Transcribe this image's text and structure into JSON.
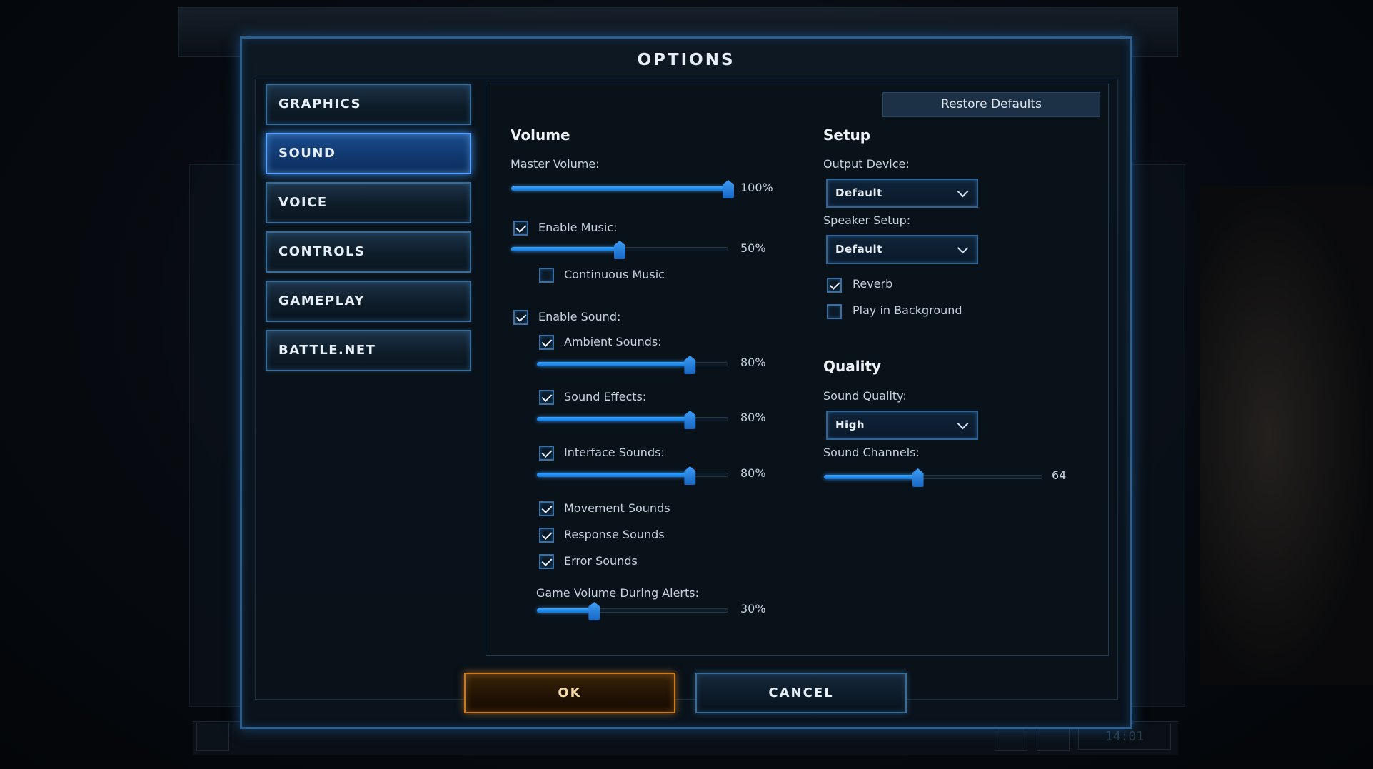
{
  "dialog": {
    "title": "OPTIONS"
  },
  "nav": {
    "items": [
      {
        "label": "GRAPHICS",
        "active": false
      },
      {
        "label": "SOUND",
        "active": true
      },
      {
        "label": "VOICE",
        "active": false
      },
      {
        "label": "CONTROLS",
        "active": false
      },
      {
        "label": "GAMEPLAY",
        "active": false
      },
      {
        "label": "BATTLE.NET",
        "active": false
      }
    ]
  },
  "restore_defaults_label": "Restore Defaults",
  "volume": {
    "title": "Volume",
    "master": {
      "label": "Master Volume:",
      "value": 1.0,
      "display": "100%"
    },
    "music": {
      "label": "Enable Music:",
      "checked": true,
      "value": 0.5,
      "display": "50%"
    },
    "continuous_music": {
      "label": "Continuous Music",
      "checked": false
    },
    "sound": {
      "label": "Enable Sound:",
      "checked": true
    },
    "ambient": {
      "label": "Ambient Sounds:",
      "checked": true,
      "value": 0.8,
      "display": "80%"
    },
    "effects": {
      "label": "Sound Effects:",
      "checked": true,
      "value": 0.8,
      "display": "80%"
    },
    "interface": {
      "label": "Interface Sounds:",
      "checked": true,
      "value": 0.8,
      "display": "80%"
    },
    "movement": {
      "label": "Movement Sounds",
      "checked": true
    },
    "response": {
      "label": "Response Sounds",
      "checked": true
    },
    "error": {
      "label": "Error Sounds",
      "checked": true
    },
    "alerts": {
      "label": "Game Volume During Alerts:",
      "value": 0.3,
      "display": "30%"
    }
  },
  "setup": {
    "title": "Setup",
    "output_device": {
      "label": "Output Device:",
      "value": "Default"
    },
    "speaker_setup": {
      "label": "Speaker Setup:",
      "value": "Default"
    },
    "reverb": {
      "label": "Reverb",
      "checked": true
    },
    "play_in_background": {
      "label": "Play in Background",
      "checked": false
    }
  },
  "quality": {
    "title": "Quality",
    "sound_quality": {
      "label": "Sound Quality:",
      "value": "High"
    },
    "sound_channels": {
      "label": "Sound Channels:",
      "value": 0.43,
      "display": "64"
    }
  },
  "buttons": {
    "ok": "OK",
    "cancel": "CANCEL"
  },
  "background": {
    "clock": "14:01"
  },
  "colors": {
    "accent": "#1f8cff",
    "ok_border": "#c77a23",
    "frame": "#2c5f8e"
  }
}
